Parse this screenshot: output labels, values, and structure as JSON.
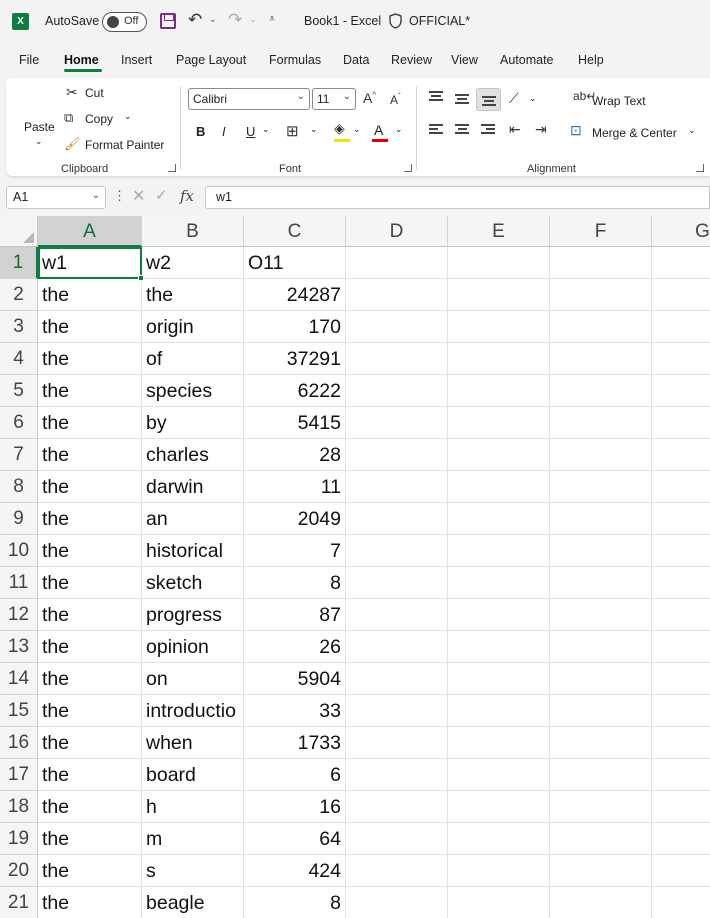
{
  "titlebar": {
    "app_logo": "X",
    "autosave_label": "AutoSave",
    "autosave_state": "Off",
    "document_title": "Book1  -  Excel",
    "sensitivity_label": "OFFICIAL*"
  },
  "tabs": [
    "File",
    "Home",
    "Insert",
    "Page Layout",
    "Formulas",
    "Data",
    "Review",
    "View",
    "Automate",
    "Help"
  ],
  "active_tab": "Home",
  "ribbon": {
    "clipboard": {
      "paste": "Paste",
      "cut": "Cut",
      "copy": "Copy",
      "format_painter": "Format Painter",
      "label": "Clipboard"
    },
    "font": {
      "font_name": "Calibri",
      "font_size": "11",
      "label": "Font",
      "bold": "B",
      "italic": "I",
      "underline": "U",
      "font_color_glyph": "A"
    },
    "alignment": {
      "wrap_text": "Wrap Text",
      "merge_center": "Merge & Center",
      "label": "Alignment"
    }
  },
  "formula_bar": {
    "name_box": "A1",
    "fx": "fx",
    "content": "w1"
  },
  "sheet": {
    "columns": [
      "A",
      "B",
      "C",
      "D",
      "E",
      "F",
      "G"
    ],
    "selected_cell": "A1",
    "rows": [
      {
        "n": "1",
        "a": "w1",
        "b": "w2",
        "c": "O11"
      },
      {
        "n": "2",
        "a": "the",
        "b": "the",
        "c": "24287"
      },
      {
        "n": "3",
        "a": "the",
        "b": "origin",
        "c": "170"
      },
      {
        "n": "4",
        "a": "the",
        "b": "of",
        "c": "37291"
      },
      {
        "n": "5",
        "a": "the",
        "b": "species",
        "c": "6222"
      },
      {
        "n": "6",
        "a": "the",
        "b": "by",
        "c": "5415"
      },
      {
        "n": "7",
        "a": "the",
        "b": "charles",
        "c": "28"
      },
      {
        "n": "8",
        "a": "the",
        "b": "darwin",
        "c": "11"
      },
      {
        "n": "9",
        "a": "the",
        "b": "an",
        "c": "2049"
      },
      {
        "n": "10",
        "a": "the",
        "b": "historical",
        "c": "7"
      },
      {
        "n": "11",
        "a": "the",
        "b": "sketch",
        "c": "8"
      },
      {
        "n": "12",
        "a": "the",
        "b": "progress",
        "c": "87"
      },
      {
        "n": "13",
        "a": "the",
        "b": "opinion",
        "c": "26"
      },
      {
        "n": "14",
        "a": "the",
        "b": "on",
        "c": "5904"
      },
      {
        "n": "15",
        "a": "the",
        "b": "introductio",
        "c": "33"
      },
      {
        "n": "16",
        "a": "the",
        "b": "when",
        "c": "1733"
      },
      {
        "n": "17",
        "a": "the",
        "b": "board",
        "c": "6"
      },
      {
        "n": "18",
        "a": "the",
        "b": "h",
        "c": "16"
      },
      {
        "n": "19",
        "a": "the",
        "b": "m",
        "c": "64"
      },
      {
        "n": "20",
        "a": "the",
        "b": "s",
        "c": "424"
      },
      {
        "n": "21",
        "a": "the",
        "b": "beagle",
        "c": "8"
      }
    ]
  },
  "colors": {
    "accent": "#107c41",
    "chrome": "#f3f3f3",
    "header_selected": "#d2d2d2"
  }
}
